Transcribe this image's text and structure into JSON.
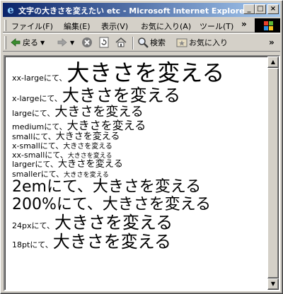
{
  "window": {
    "title": "文字の大きさを変えたい etc - Microsoft Internet Explorer",
    "minimize_glyph": "_",
    "maximize_glyph": "□",
    "close_glyph": "×"
  },
  "menu": {
    "items": [
      "ファイル(F)",
      "編集(E)",
      "表示(V)",
      "お気に入り(A)",
      "ツール(T)"
    ],
    "overflow": "»"
  },
  "toolbar": {
    "back_label": "戻る",
    "search_label": "検索",
    "favorites_label": "お気に入り",
    "overflow": "»"
  },
  "page": {
    "sample_text": "大きさを変える",
    "rows": [
      {
        "label": "xx-largeにて、",
        "size": "xx-large"
      },
      {
        "label": "x-largeにて、",
        "size": "x-large"
      },
      {
        "label": "largeにて、",
        "size": "large"
      },
      {
        "label": "mediumにて、",
        "size": "medium"
      },
      {
        "label": "smallにて、",
        "size": "small"
      },
      {
        "label": "x-smallにて、",
        "size": "x-small"
      },
      {
        "label": "xx-smallにて、",
        "size": "xx-small"
      },
      {
        "label": "largerにて、",
        "size": "larger"
      },
      {
        "label": "smallerにて、",
        "size": "smaller"
      },
      {
        "label": "2emにて、",
        "size": "2em"
      },
      {
        "label": "200%にて、",
        "size": "200%"
      },
      {
        "label": "24pxにて、",
        "size": "24px"
      },
      {
        "label": "18ptにて、",
        "size": "18pt"
      }
    ]
  },
  "colors": {
    "title_gradient_start": "#0a246a",
    "title_gradient_end": "#a6caf0",
    "chrome": "#d4d0c8",
    "page_background": "#ffffff"
  }
}
